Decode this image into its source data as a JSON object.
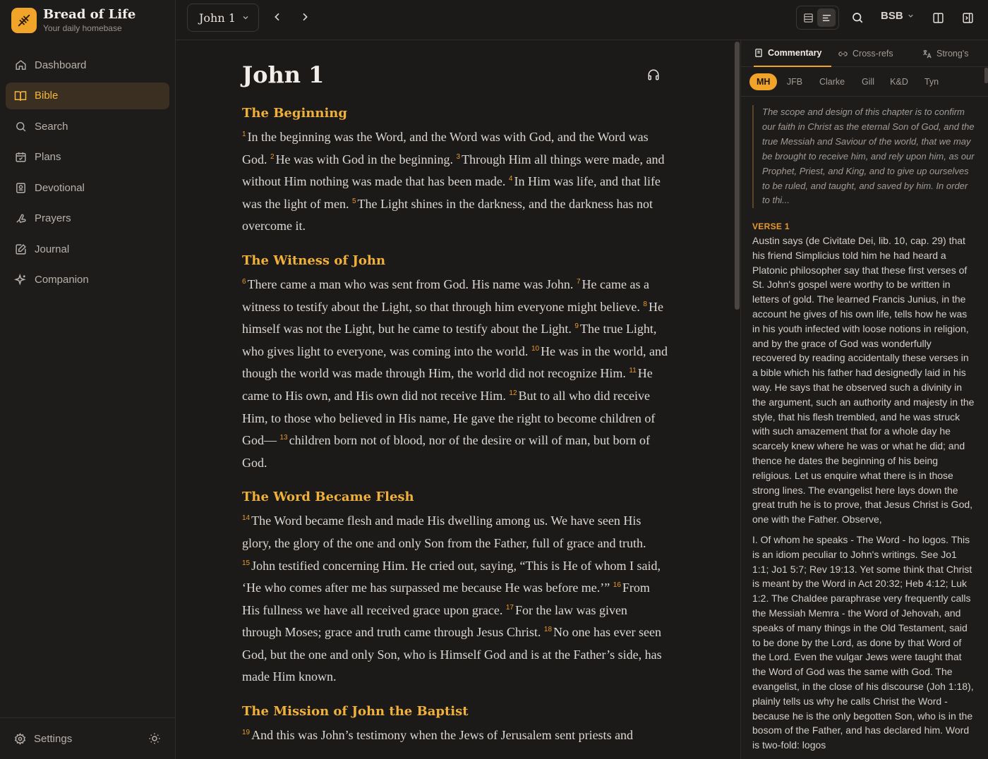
{
  "brand": {
    "title": "Bread of Life",
    "subtitle": "Your daily homebase"
  },
  "sidebar": {
    "items": [
      {
        "label": "Dashboard",
        "icon": "home-icon",
        "active": false
      },
      {
        "label": "Bible",
        "icon": "book-icon",
        "active": true
      },
      {
        "label": "Search",
        "icon": "search-icon",
        "active": false
      },
      {
        "label": "Plans",
        "icon": "calendar-icon",
        "active": false
      },
      {
        "label": "Devotional",
        "icon": "devotional-icon",
        "active": false
      },
      {
        "label": "Prayers",
        "icon": "prayer-icon",
        "active": false
      },
      {
        "label": "Journal",
        "icon": "journal-icon",
        "active": false
      },
      {
        "label": "Companion",
        "icon": "sparkles-icon",
        "active": false
      }
    ],
    "settings_label": "Settings"
  },
  "topbar": {
    "chapter": "John 1",
    "version": "BSB"
  },
  "reader": {
    "title": "John 1",
    "sections": [
      {
        "heading": "The Beginning",
        "verses": [
          {
            "n": "1",
            "text": "In the beginning was the Word, and the Word was with God, and the Word was God."
          },
          {
            "n": "2",
            "text": "He was with God in the beginning."
          },
          {
            "n": "3",
            "text": "Through Him all things were made, and without Him nothing was made that has been made."
          },
          {
            "n": "4",
            "text": "In Him was life, and that life was the light of men."
          },
          {
            "n": "5",
            "text": "The Light shines in the darkness, and the darkness has not overcome it."
          }
        ]
      },
      {
        "heading": "The Witness of John",
        "verses": [
          {
            "n": "6",
            "text": "There came a man who was sent from God. His name was John."
          },
          {
            "n": "7",
            "text": "He came as a witness to testify about the Light, so that through him everyone might believe."
          },
          {
            "n": "8",
            "text": "He himself was not the Light, but he came to testify about the Light."
          },
          {
            "n": "9",
            "text": "The true Light, who gives light to everyone, was coming into the world."
          },
          {
            "n": "10",
            "text": "He was in the world, and though the world was made through Him, the world did not recognize Him."
          },
          {
            "n": "11",
            "text": "He came to His own, and His own did not receive Him."
          },
          {
            "n": "12",
            "text": "But to all who did receive Him, to those who believed in His name, He gave the right to become children of God—"
          },
          {
            "n": "13",
            "text": "children born not of blood, nor of the desire or will of man, but born of God."
          }
        ]
      },
      {
        "heading": "The Word Became Flesh",
        "verses": [
          {
            "n": "14",
            "text": "The Word became flesh and made His dwelling among us. We have seen His glory, the glory of the one and only Son from the Father, full of grace and truth."
          },
          {
            "n": "15",
            "text": "John testified concerning Him. He cried out, saying, “This is He of whom I said, ‘He who comes after me has surpassed me because He was before me.’”"
          },
          {
            "n": "16",
            "text": "From His fullness we have all received grace upon grace."
          },
          {
            "n": "17",
            "text": "For the law was given through Moses; grace and truth came through Jesus Christ."
          },
          {
            "n": "18",
            "text": "No one has ever seen God, but the one and only Son, who is Himself God and is at the Father’s side, has made Him known."
          }
        ]
      },
      {
        "heading": "The Mission of John the Baptist",
        "verses": [
          {
            "n": "19",
            "text": "And this was John’s testimony when the Jews of Jerusalem sent priests and"
          }
        ]
      }
    ]
  },
  "panel": {
    "tabs": [
      {
        "label": "Commentary",
        "icon": "commentary-icon",
        "active": true
      },
      {
        "label": "Cross-refs",
        "icon": "link-icon",
        "active": false
      },
      {
        "label": "Strong's",
        "icon": "translate-icon",
        "active": false
      }
    ],
    "sources": [
      {
        "label": "MH",
        "active": true
      },
      {
        "label": "JFB",
        "active": false
      },
      {
        "label": "Clarke",
        "active": false
      },
      {
        "label": "Gill",
        "active": false
      },
      {
        "label": "K&D",
        "active": false
      },
      {
        "label": "Tyn",
        "active": false
      }
    ],
    "intro": "The scope and design of this chapter is to confirm our faith in Christ as the eternal Son of God, and the true Messiah and Saviour of the world, that we may be brought to receive him, and rely upon him, as our Prophet, Priest, and King, and to give up ourselves to be ruled, and taught, and saved by him. In order to thi...",
    "verse_label": "VERSE 1",
    "paragraphs": [
      "Austin says (de Civitate Dei, lib. 10, cap. 29) that his friend Simplicius told him he had heard a Platonic philosopher say that these first verses of St. John's gospel were worthy to be written in letters of gold. The learned Francis Junius, in the account he gives of his own life, tells how he was in his youth infected with loose notions in religion, and by the grace of God was wonderfully recovered by reading accidentally these verses in a bible which his father had designedly laid in his way. He says that he observed such a divinity in the argument, such an authority and majesty in the style, that his flesh trembled, and he was struck with such amazement that for a whole day he scarcely knew where he was or what he did; and thence he dates the beginning of his being religious. Let us enquire what there is in those strong lines. The evangelist here lays down the great truth he is to prove, that Jesus Christ is God, one with the Father. Observe,",
      "I. Of whom he speaks - The Word - ho logos. This is an idiom peculiar to John's writings. See Jo1 1:1; Jo1 5:7; Rev 19:13. Yet some think that Christ is meant by the Word in Act 20:32; Heb 4:12; Luk 1:2. The Chaldee paraphrase very frequently calls the Messiah Memra - the Word of Jehovah, and speaks of many things in the Old Testament, said to be done by the Lord, as done by that Word of the Lord. Even the vulgar Jews were taught that the Word of God was the same with God. The evangelist, in the close of his discourse (Joh 1:18), plainly tells us why he calls Christ the Word - because he is the only begotten Son, who is in the bosom of the Father, and has declared him. Word is two-fold: logos"
    ]
  },
  "colors": {
    "accent": "#f0a52a",
    "heading": "#efb13a",
    "verse_number": "#e8992a",
    "background": "#1c1a19"
  }
}
